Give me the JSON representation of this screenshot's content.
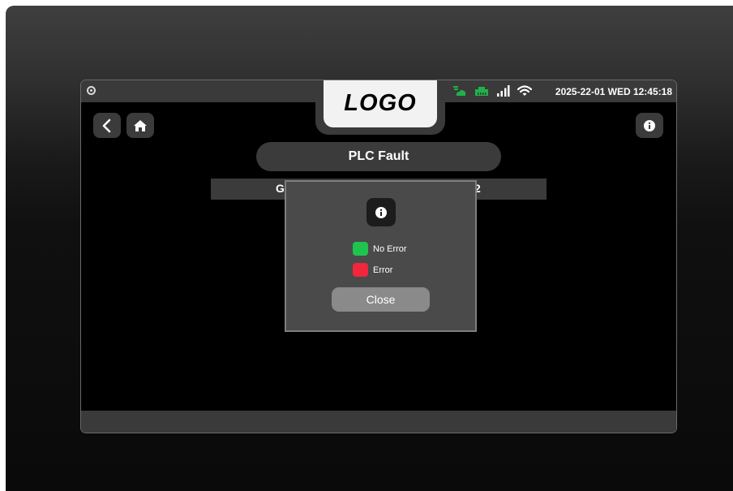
{
  "status_bar": {
    "datetime": "2025-22-01 WED 12:45:18",
    "icons": [
      "camera-icon",
      "cloud-sync-icon",
      "ethernet-icon",
      "signal-bars-icon",
      "wifi-icon"
    ],
    "icon_color_green": "#1fb24a"
  },
  "logo": {
    "text": "LOGO"
  },
  "nav": {
    "icons": [
      "chevron-left-icon",
      "home-icon",
      "info-icon"
    ]
  },
  "page": {
    "title": "PLC Fault"
  },
  "table": {
    "header_left_char": "G",
    "header_right_char": "2"
  },
  "modal": {
    "icon": "info-icon",
    "legend": [
      {
        "label": "No Error",
        "color": "#1fc44f"
      },
      {
        "label": "Error",
        "color": "#f2263c"
      }
    ],
    "close_label": "Close"
  }
}
